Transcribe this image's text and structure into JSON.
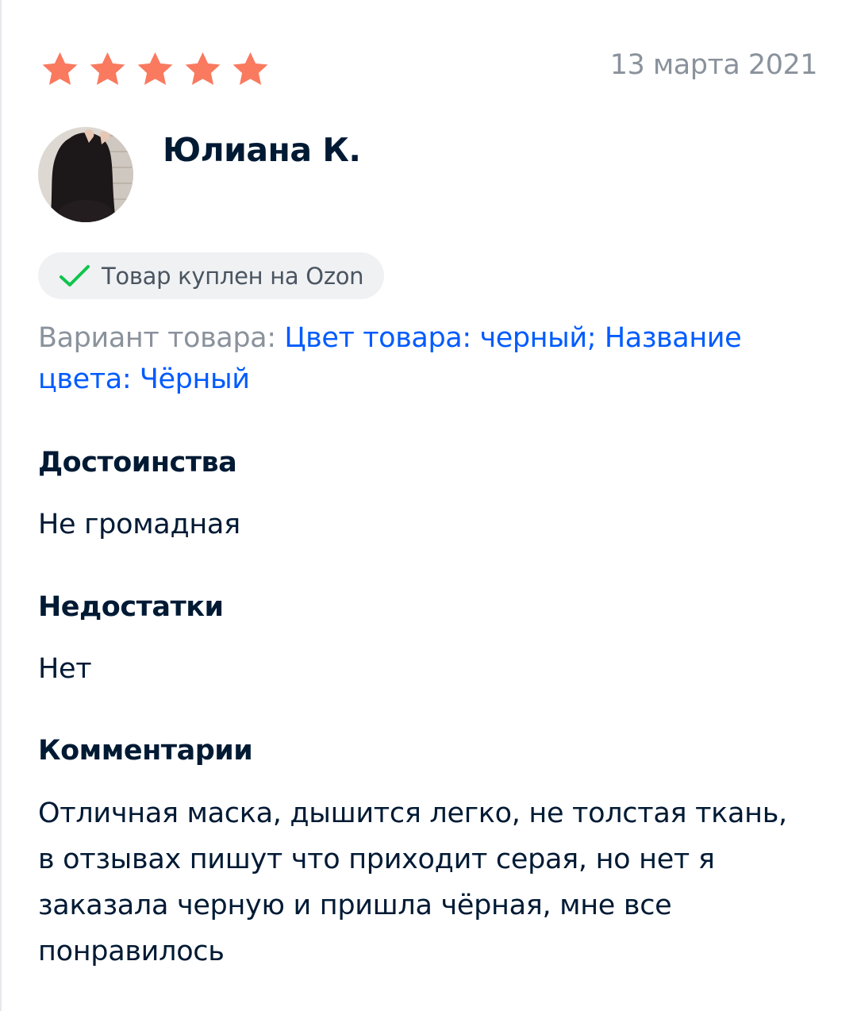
{
  "review": {
    "rating": 5,
    "rating_max": 5,
    "date": "13 марта 2021",
    "author": "Юлиана К.",
    "purchased_badge": "Товар куплен на Ozon",
    "variant_label": "Вариант товара:",
    "variant_value": "Цвет товара: черный; Название цвета: Чёрный",
    "pros_title": "Достоинства",
    "pros_text": "Не громадная",
    "cons_title": "Недостатки",
    "cons_text": "Нет",
    "comment_title": "Комментарии",
    "comment_text": "Отличная маска, дышится легко, не толстая ткань, в отзывах пишут что приходит серая, но нет я заказала черную и пришла чёрная, мне все понравилось"
  },
  "colors": {
    "star": "#f97a5f",
    "accent_link": "#005bff",
    "check_green": "#10c44c",
    "muted_text": "#8a929c",
    "badge_bg": "#eff1f3"
  },
  "icons": {
    "rating": "star-icon",
    "purchased": "check-icon"
  }
}
